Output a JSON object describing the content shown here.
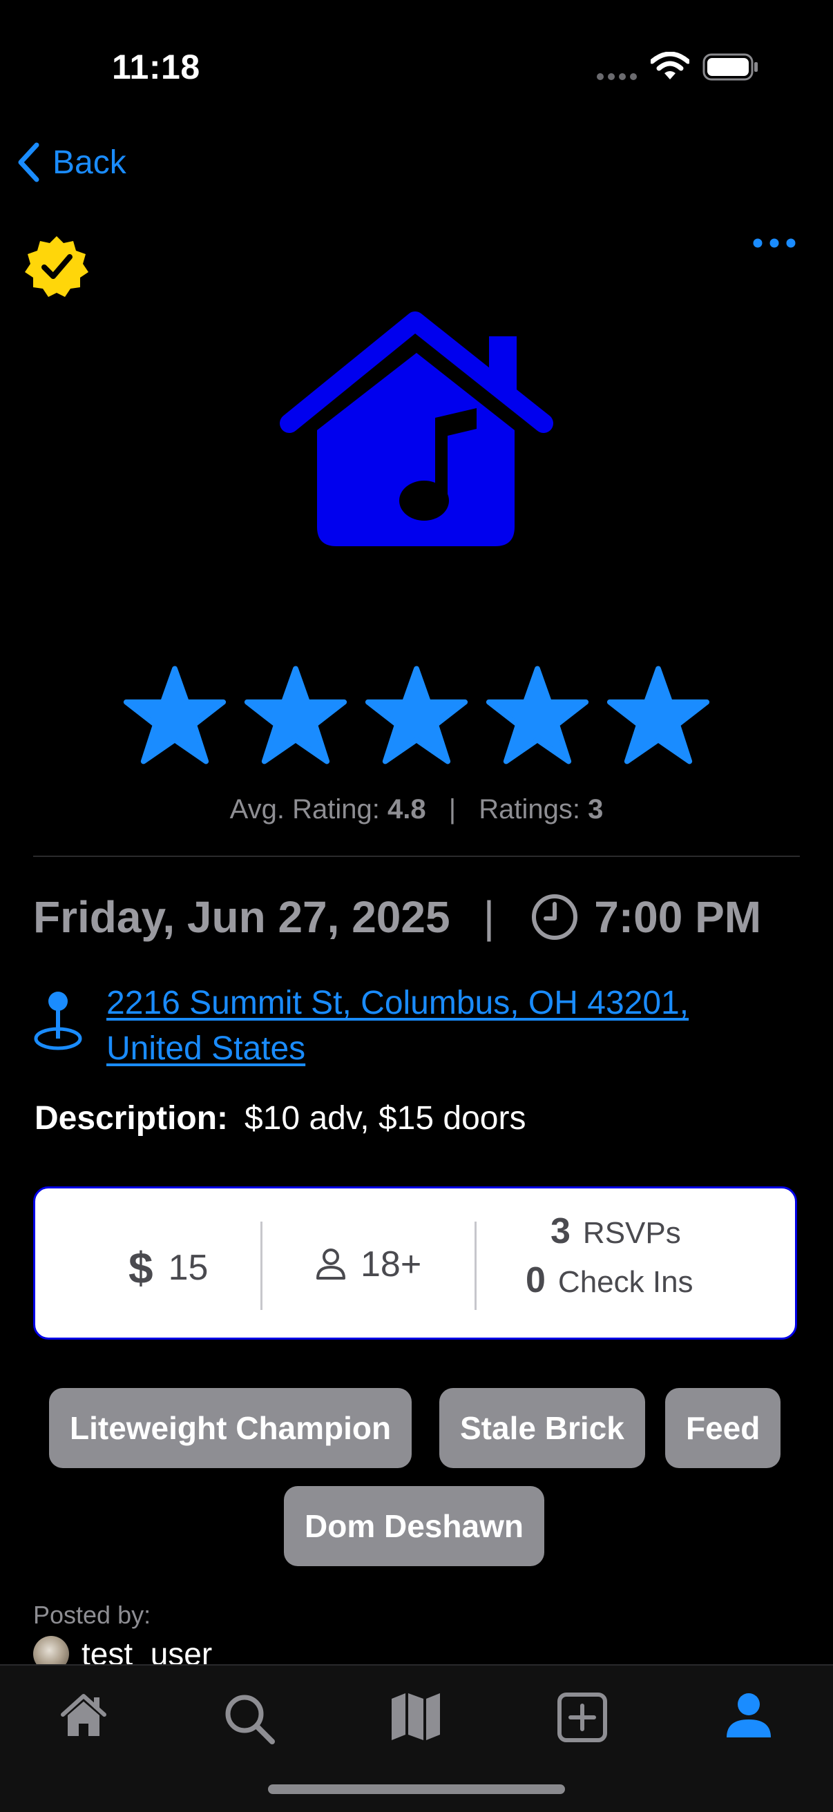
{
  "status_bar": {
    "time": "11:18",
    "icons": [
      "cellular-dots-icon",
      "wifi-icon",
      "battery-icon"
    ]
  },
  "nav": {
    "back_label": "Back",
    "more_icon": "ellipsis-icon",
    "verified_icon": "verified-badge-icon"
  },
  "event": {
    "icon": "house-music-icon",
    "rating": {
      "stars_filled": 5,
      "stars_total": 5,
      "avg_label": "Avg. Rating:",
      "avg_value": "4.8",
      "separator": "|",
      "count_label": "Ratings:",
      "count_value": "3"
    },
    "date": "Friday, Jun 27, 2025",
    "date_time_separator": "|",
    "time": "7:00 PM",
    "address_line1": "2216 Summit St, Columbus, OH  43201,",
    "address_line2": "United States",
    "description_label": "Description:",
    "description": "$10 adv, $15 doors"
  },
  "info_card": {
    "price_symbol": "$",
    "price": "15",
    "age": "18+",
    "rsvp_count": "3",
    "rsvp_label": "RSVPs",
    "checkin_count": "0",
    "checkin_label": "Check Ins"
  },
  "artists": [
    "Liteweight Champion",
    "Stale Brick",
    "Feed",
    "Dom Deshawn"
  ],
  "poster": {
    "label": "Posted by:",
    "username": "test_user"
  },
  "tab_bar": {
    "tabs": [
      {
        "icon": "home-icon",
        "active": false
      },
      {
        "icon": "search-icon",
        "active": false
      },
      {
        "icon": "map-icon",
        "active": false
      },
      {
        "icon": "add-icon",
        "active": false
      },
      {
        "icon": "profile-icon",
        "active": true
      }
    ]
  },
  "colors": {
    "accent": "#1a8cff",
    "venue_icon": "#0000ee",
    "verified": "#ffd60a",
    "tag_bg": "#8e8e93"
  }
}
